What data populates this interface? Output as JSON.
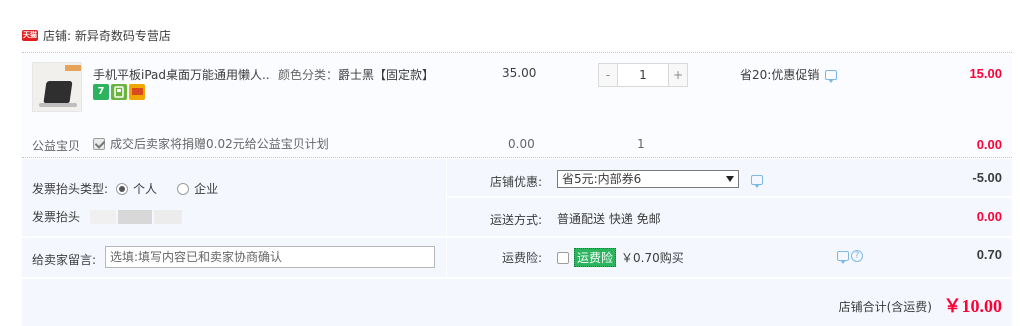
{
  "store": {
    "badge": "天猫",
    "label": "店铺: 新异奇数码专营店"
  },
  "item": {
    "title": "手机平板iPad桌面万能通用懒人...",
    "sku_label": "颜色分类：",
    "sku_value": "爵士黑【固定款】",
    "service_icons": [
      "seven-day-return-icon",
      "quality-icon",
      "credit-card-icon"
    ],
    "service_7": "7",
    "unit_price": "35.00",
    "quantity": "1",
    "minus": "-",
    "plus": "+",
    "promotion": "省20:优惠促销",
    "total": "15.00"
  },
  "charity": {
    "label": "公益宝贝",
    "text": "成交后卖家将捐赠0.02元给公益宝贝计划",
    "checked": true,
    "price": "0.00",
    "quantity": "1",
    "total": "0.00"
  },
  "invoice": {
    "type_label": "发票抬头类型:",
    "options": [
      "个人",
      "企业"
    ],
    "selected": "个人",
    "title_label": "发票抬头"
  },
  "message": {
    "label": "给卖家留言:",
    "placeholder": "选填:填写内容已和卖家协商确认"
  },
  "shop_discount": {
    "label": "店铺优惠:",
    "selected": "省5元:内部券6",
    "value": "-5.00"
  },
  "shipping": {
    "label": "运送方式:",
    "value": "普通配送 快递 免邮",
    "cost": "0.00"
  },
  "insurance": {
    "label": "运费险:",
    "tag": "运费险",
    "price_text": "￥0.70购买",
    "value": "0.70"
  },
  "summary": {
    "label": "店铺合计(含运费)",
    "value": "￥10.00"
  },
  "colors": {
    "price_red": "#ff0036",
    "row_bg": "#f4f8fe",
    "insurance_green": "#2bb35e"
  }
}
